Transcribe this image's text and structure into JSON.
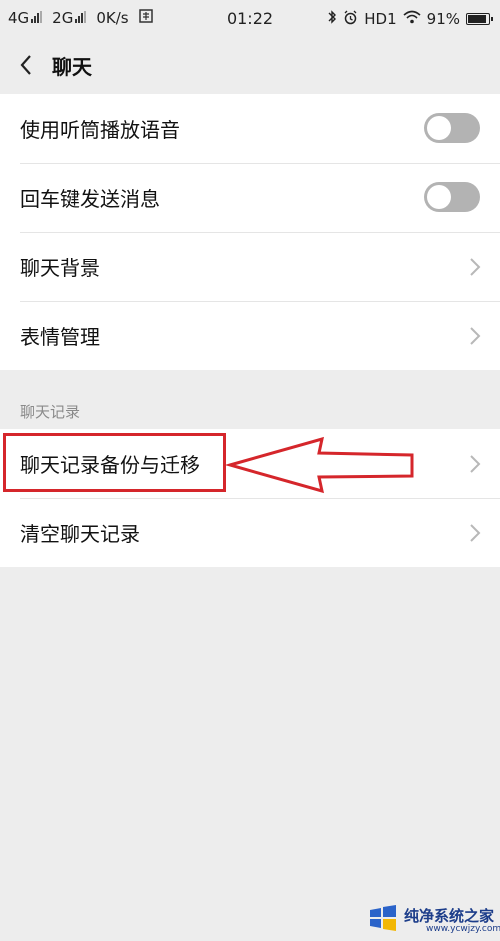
{
  "status_bar": {
    "net1": "4G",
    "net2": "2G",
    "speed": "0K/s",
    "time": "01:22",
    "hd": "HD1",
    "battery": "91%"
  },
  "header": {
    "title": "聊天"
  },
  "group1": [
    {
      "label": "使用听筒播放语音",
      "control": "toggle",
      "on": false
    },
    {
      "label": "回车键发送消息",
      "control": "toggle",
      "on": false
    },
    {
      "label": "聊天背景",
      "control": "chevron"
    },
    {
      "label": "表情管理",
      "control": "chevron"
    }
  ],
  "section_title": "聊天记录",
  "group2": [
    {
      "label": "聊天记录备份与迁移",
      "control": "chevron"
    },
    {
      "label": "清空聊天记录",
      "control": "chevron"
    }
  ],
  "annotation": {
    "color": "#d5262b"
  },
  "watermark": {
    "name": "纯净系统之家",
    "url": "www.ycwjzy.com"
  },
  "colors": {
    "background": "#ededed",
    "toggle_off": "#b3b3b3",
    "accent_annotation": "#d5262b"
  }
}
